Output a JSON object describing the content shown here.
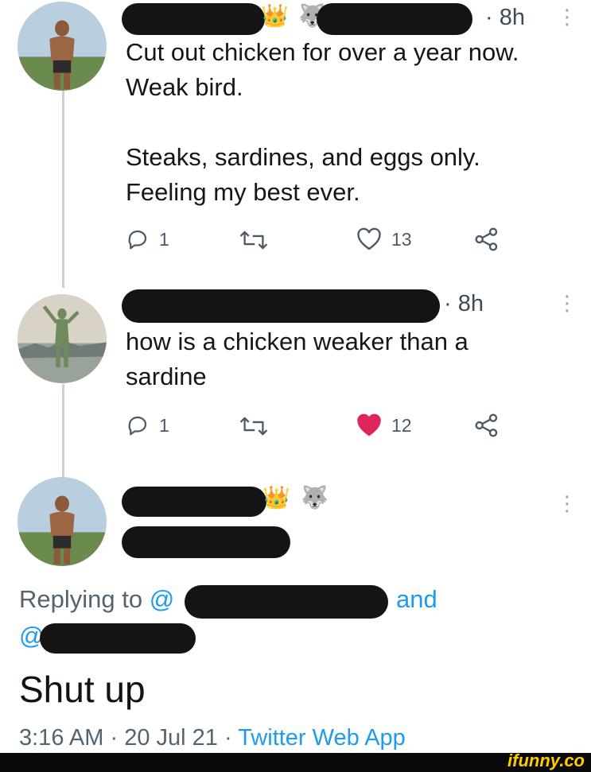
{
  "tweets": [
    {
      "timestamp": "· 8h",
      "text_lines": [
        "Cut out chicken for over a year now.",
        "Weak bird.",
        "",
        "Steaks, sardines, and eggs only.",
        "Feeling my best ever."
      ],
      "replies": "1",
      "likes": "13",
      "liked": false
    },
    {
      "timestamp": "· 8h",
      "text_lines": [
        "how is a chicken weaker than a",
        "sardine"
      ],
      "replies": "1",
      "likes": "12",
      "liked": true
    }
  ],
  "emojis": {
    "crown": "👑",
    "wolf": "🐺"
  },
  "main_tweet": {
    "replying_prefix": "Replying to",
    "at_sign": "@",
    "and_text": "and",
    "text": "Shut up",
    "time": "3:16 AM",
    "date": "20 Jul 21",
    "source": "Twitter Web App",
    "separator": "·"
  },
  "watermark": "ifunny.co",
  "colors": {
    "accent": "#1d9bf0",
    "like_red": "#e0245e",
    "thread_line": "#c9d1d8"
  },
  "icons": [
    "reply-icon",
    "retweet-icon",
    "like-icon",
    "share-icon",
    "more-icon"
  ]
}
